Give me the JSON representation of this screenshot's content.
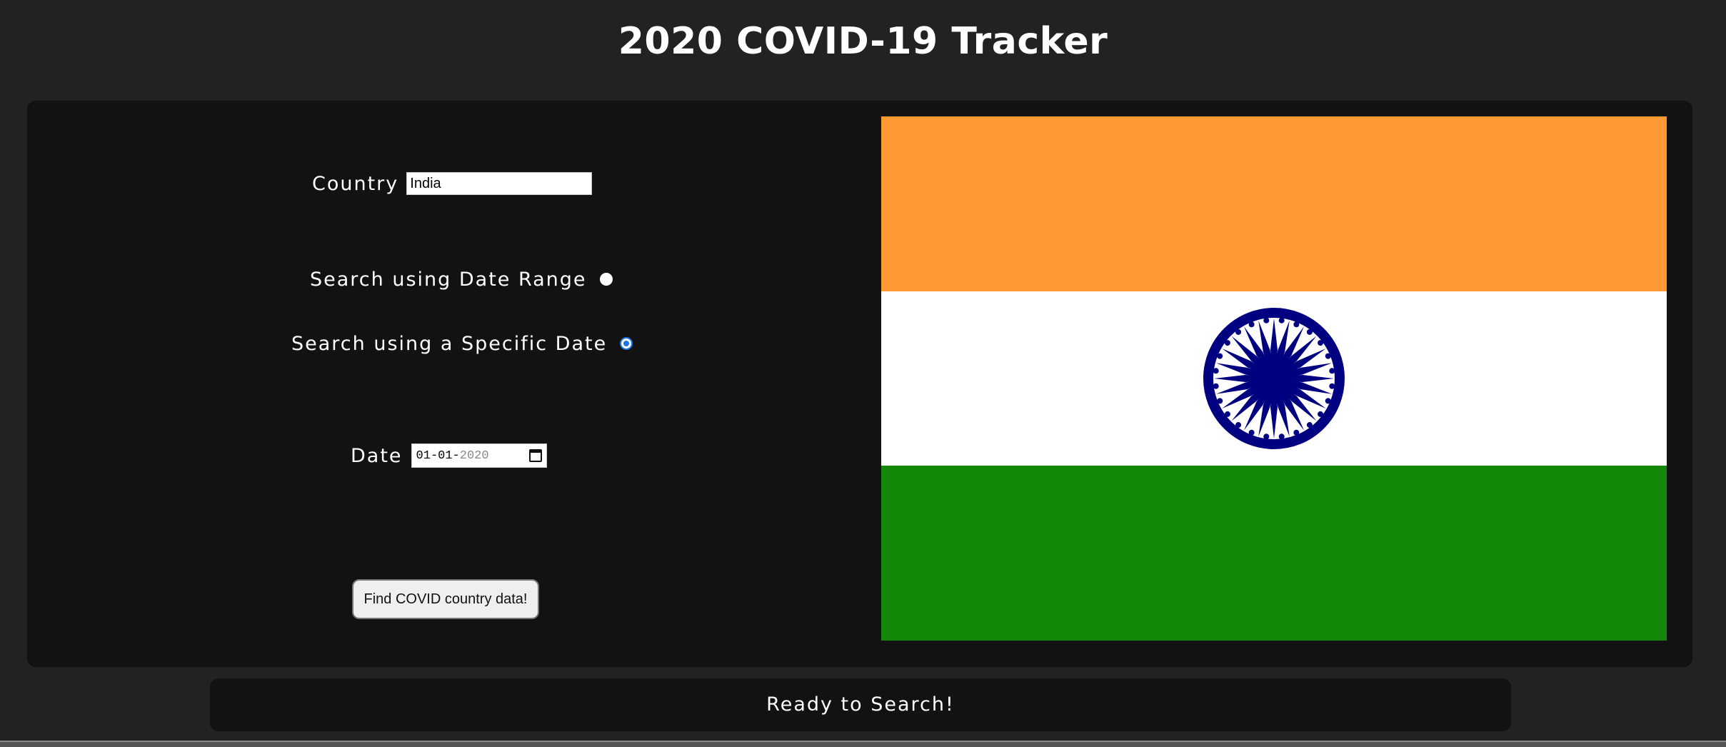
{
  "header": {
    "title": "2020 COVID-19 Tracker"
  },
  "form": {
    "country_label": "Country",
    "country_value": "India",
    "date_range_label": "Search using Date Range",
    "date_range_selected": false,
    "specific_date_label": "Search using a Specific Date",
    "specific_date_selected": true,
    "date_label": "Date",
    "date_day_month": "01-01-",
    "date_year": "2020",
    "submit_label": "Find COVID country data!"
  },
  "flag": {
    "country": "India",
    "colors": {
      "saffron": "#ff9933",
      "white": "#ffffff",
      "green": "#138808",
      "chakra": "#000080"
    }
  },
  "status": {
    "message": "Ready to Search!"
  },
  "icons": {
    "calendar": "calendar-icon",
    "chakra": "ashoka-chakra-icon"
  }
}
